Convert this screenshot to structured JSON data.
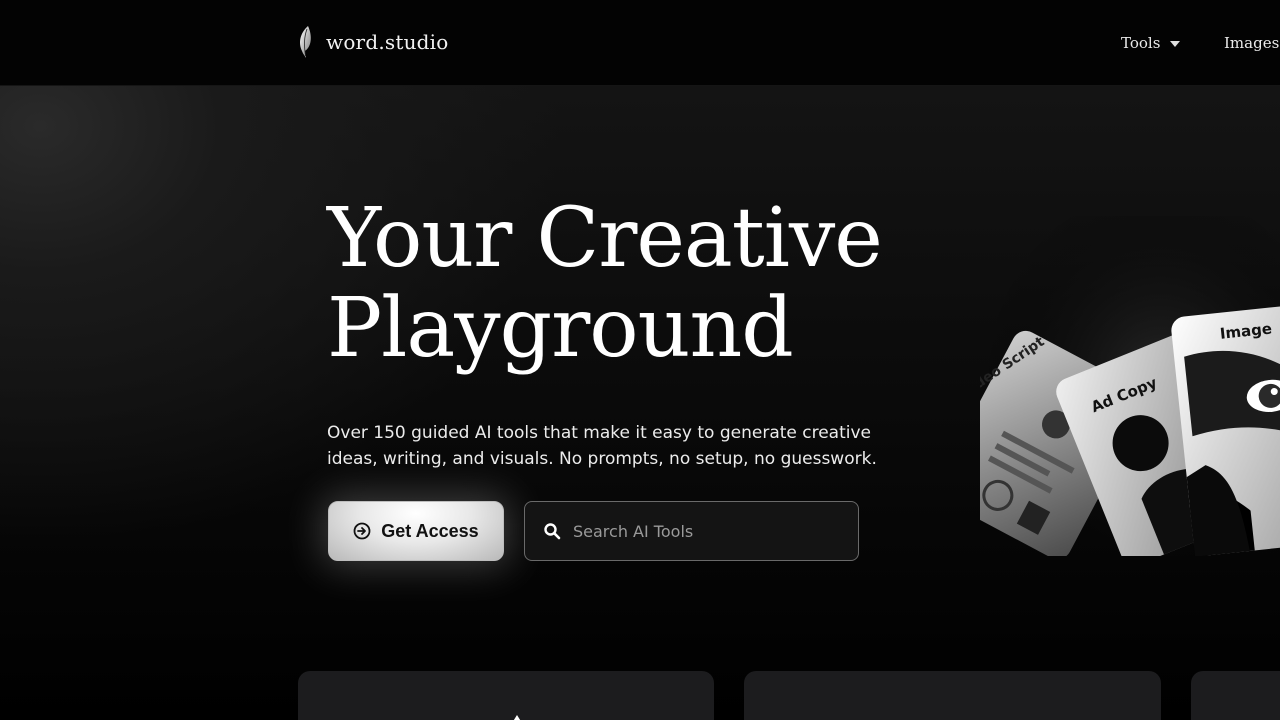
{
  "header": {
    "logo_text": "word.studio",
    "logo_icon": "feather-icon",
    "nav": [
      {
        "label": "Tools",
        "has_dropdown": true
      },
      {
        "label": "Images",
        "has_dropdown": false
      }
    ]
  },
  "hero": {
    "title_line1": "Your Creative",
    "title_line2": "Playground",
    "subtitle": "Over 150 guided AI tools that make it easy to generate creative ideas, writing, and visuals. No prompts, no setup, no guesswork.",
    "cta_label": "Get Access",
    "cta_icon": "arrow-circle-right-icon",
    "search_placeholder": "Search AI Tools",
    "search_value": "",
    "art_labels": {
      "video": "Video Script",
      "adcopy": "Ad Copy",
      "image": "Image"
    }
  },
  "colors": {
    "background": "#000000",
    "header_bg": "#030303",
    "card_bg": "#1c1c1e",
    "cta_bg": "#e8e8e8",
    "text_primary": "#ffffff"
  }
}
